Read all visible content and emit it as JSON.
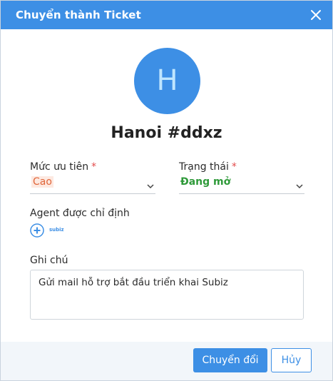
{
  "dialog": {
    "title": "Chuyển thành Ticket",
    "avatar_letter": "H",
    "ticket_name": "Hanoi #ddxz"
  },
  "form": {
    "priority": {
      "label": "Mức ưu tiên",
      "required": "*",
      "value": "Cao"
    },
    "status": {
      "label": "Trạng thái",
      "required": "*",
      "value": "Đang mở"
    },
    "agent": {
      "label": "Agent được chỉ định",
      "logo": "subiz"
    },
    "note": {
      "label": "Ghi chú",
      "value": "Gửi mail hỗ trợ bắt đầu triển khai Subiz"
    }
  },
  "actions": {
    "convert": "Chuyển đổi",
    "cancel": "Hủy"
  },
  "icons": {
    "close": "close-icon",
    "chevron": "chevron-down-icon",
    "add": "plus-circle-icon"
  },
  "colors": {
    "accent": "#3d8fe5",
    "priority": "#e0663a",
    "status": "#2f9a3a",
    "required": "#e34b4b"
  }
}
